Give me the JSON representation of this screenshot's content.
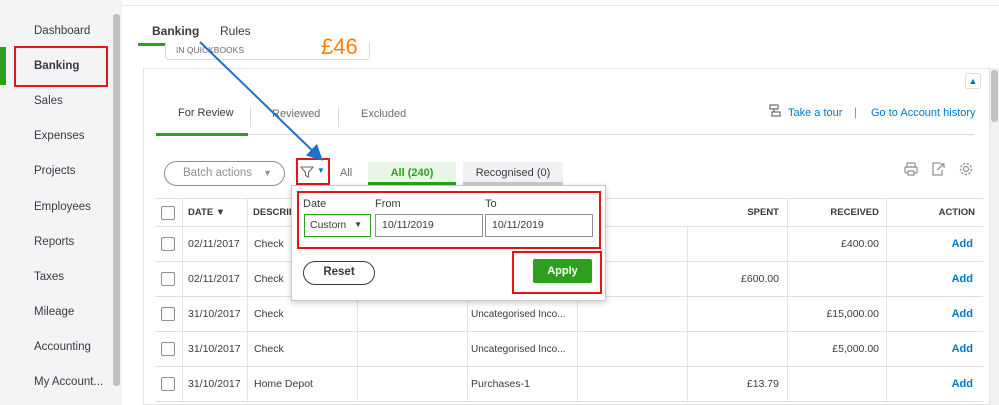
{
  "sidebar": {
    "items": [
      {
        "label": "Dashboard"
      },
      {
        "label": "Banking"
      },
      {
        "label": "Sales"
      },
      {
        "label": "Expenses"
      },
      {
        "label": "Projects"
      },
      {
        "label": "Employees"
      },
      {
        "label": "Reports"
      },
      {
        "label": "Taxes"
      },
      {
        "label": "Mileage"
      },
      {
        "label": "Accounting"
      },
      {
        "label": "My Account..."
      }
    ]
  },
  "tabs": {
    "banking": "Banking",
    "rules": "Rules"
  },
  "card": {
    "label": "IN QUICKBOOKS",
    "amount": "£46"
  },
  "review_tabs": {
    "for_review": "For Review",
    "reviewed": "Reviewed",
    "excluded": "Excluded"
  },
  "links": {
    "take_tour": "Take a tour",
    "account_history": "Go to Account history"
  },
  "toolbar": {
    "batch_actions": "Batch actions",
    "all": "All",
    "chip_all": "All (240)",
    "chip_recognised": "Recognised (0)"
  },
  "filter": {
    "date_label": "Date",
    "from_label": "From",
    "to_label": "To",
    "date_value": "Custom",
    "from_value": "10/11/2019",
    "to_value": "10/11/2019",
    "reset": "Reset",
    "apply": "Apply"
  },
  "table": {
    "headers": {
      "date": "DATE ▼",
      "description": "DESCRIPTION",
      "spent": "SPENT",
      "received": "RECEIVED",
      "action": "ACTION"
    },
    "rows": [
      {
        "date": "02/11/2017",
        "description": "Check",
        "category": "",
        "spent": "",
        "received": "£400.00",
        "action": "Add"
      },
      {
        "date": "02/11/2017",
        "description": "Check",
        "category": "",
        "spent": "£600.00",
        "received": "",
        "action": "Add"
      },
      {
        "date": "31/10/2017",
        "description": "Check",
        "category": "Uncategorised Inco...",
        "spent": "",
        "received": "£15,000.00",
        "action": "Add"
      },
      {
        "date": "31/10/2017",
        "description": "Check",
        "category": "Uncategorised Inco...",
        "spent": "",
        "received": "£5,000.00",
        "action": "Add"
      },
      {
        "date": "31/10/2017",
        "description": "Home Depot",
        "category": "Purchases-1",
        "spent": "£13.79",
        "received": "",
        "action": "Add"
      }
    ]
  },
  "colors": {
    "accent_green": "#2ca01c",
    "link_blue": "#0077c5",
    "highlight_red": "#e0161b",
    "orange": "#ff8000"
  }
}
